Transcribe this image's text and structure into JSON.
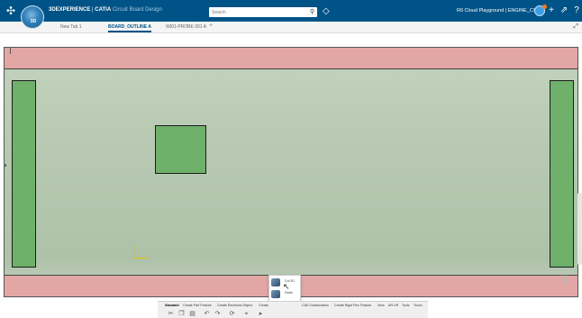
{
  "header": {
    "logo_icon": "3ds-logo-icon",
    "compass_label": "3D",
    "app_brand": "3DEXPERIENCE",
    "app_name": "CATIA",
    "app_role": "Circuit Board Design",
    "search_placeholder": "Search",
    "platform_label": "R0 Cloud Playground | ENGINE_CS",
    "icons": [
      "search-icon",
      "tag-icon",
      "add-icon",
      "share-icon",
      "help-icon"
    ]
  },
  "tabs": [
    {
      "label": "New Tab 1",
      "active": false
    },
    {
      "label": "BOARD_OUTLINE A",
      "active": true
    },
    {
      "label": "WI01-PROBE 001 A",
      "active": false
    }
  ],
  "palette": {
    "items": [
      {
        "label": "Cut 3D",
        "icon": "cut-icon"
      },
      {
        "label": "Paste",
        "icon": "paste-icon"
      },
      {
        "label": "Select 3D",
        "icon": "select-icon"
      }
    ]
  },
  "action_bar": {
    "sections": [
      "Standard",
      "Create Part Feature",
      "Create Electronic Object",
      "Create",
      "CAD Collaboration",
      "Create Rigid Flex Feature",
      "View",
      "AR-VR",
      "Tools",
      "Touch"
    ],
    "active_section": "Standard",
    "tools": [
      "cut-icon",
      "copy-icon",
      "paste-icon",
      "undo-icon",
      "redo-icon",
      "update-icon",
      "measure-icon",
      "more-icon"
    ]
  },
  "colors": {
    "header_bg": "#005386",
    "board_fill": "#b6c8b1",
    "rail_fill": "#e2a7a5",
    "pad_fill": "#6fb06a",
    "axis": "#e0c000"
  }
}
